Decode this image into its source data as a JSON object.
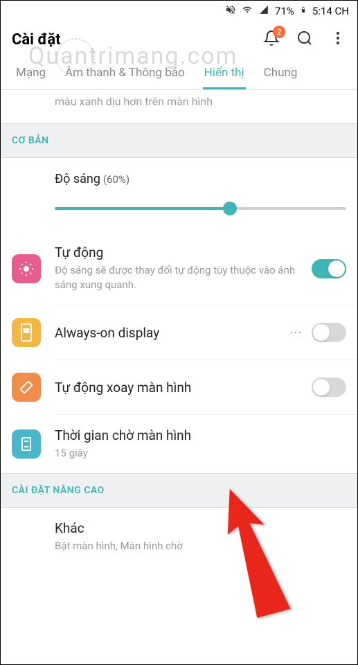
{
  "status_bar": {
    "battery": "71%",
    "time": "5:14 CH"
  },
  "header": {
    "title": "Cài đặt",
    "notification_badge": "2"
  },
  "tabs": {
    "items": [
      {
        "label": "Mạng",
        "active": false
      },
      {
        "label": "Âm thanh & Thông báo",
        "active": false
      },
      {
        "label": "Hiển thị",
        "active": true
      },
      {
        "label": "Chung",
        "active": false
      }
    ]
  },
  "partial_item": {
    "text": "màu xanh dịu hơn trên màn hình"
  },
  "sections": {
    "basic": {
      "header": "CƠ BẢN",
      "brightness": {
        "label": "Độ sáng",
        "percent": "(60%)",
        "value": 60
      },
      "auto": {
        "title": "Tự động",
        "subtitle": "Độ sáng sẽ được thay đổi tự động tùy thuộc vào ánh sáng xung quanh.",
        "enabled": true
      },
      "always_on": {
        "title": "Always-on display",
        "enabled": false
      },
      "auto_rotate": {
        "title": "Tự động xoay màn hình",
        "enabled": false
      },
      "screen_timeout": {
        "title": "Thời gian chờ màn hình",
        "subtitle": "15 giây"
      }
    },
    "advanced": {
      "header": "CÀI ĐẶT NÂNG CAO",
      "other": {
        "title": "Khác",
        "subtitle": "Bật màn hình, Màn hình chờ"
      }
    }
  },
  "watermark": "Quantrimang.com"
}
